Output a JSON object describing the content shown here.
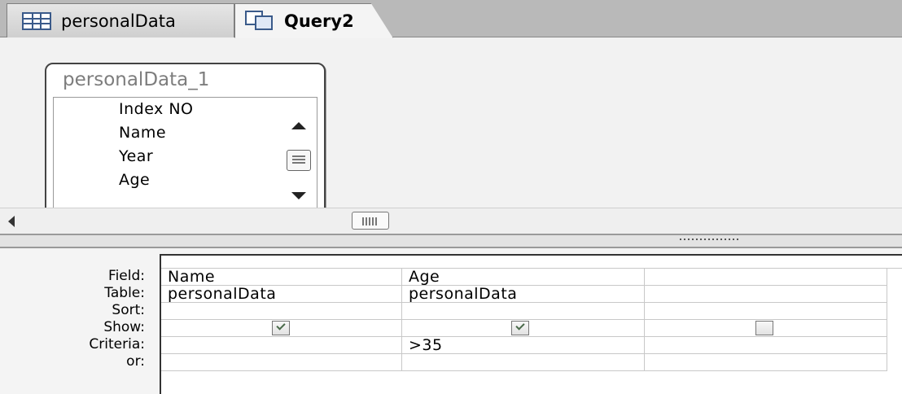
{
  "tabs": [
    {
      "label": "personalData",
      "icon": "table-icon",
      "active": false
    },
    {
      "label": "Query2",
      "icon": "query-icon",
      "active": true
    }
  ],
  "field_list": {
    "title": "personalData_1",
    "fields": [
      "Index NO",
      "Name",
      "Year",
      "Age"
    ]
  },
  "grid": {
    "row_labels": [
      "Field:",
      "Table:",
      "Sort:",
      "Show:",
      "Criteria:",
      "or:"
    ],
    "columns": [
      {
        "field": "Name",
        "table": "personalData",
        "sort": "",
        "show": true,
        "criteria": "",
        "or": ""
      },
      {
        "field": "Age",
        "table": "personalData",
        "sort": "",
        "show": true,
        "criteria": ">35",
        "or": ""
      },
      {
        "field": "",
        "table": "",
        "sort": "",
        "show": false,
        "criteria": "",
        "or": ""
      }
    ]
  }
}
